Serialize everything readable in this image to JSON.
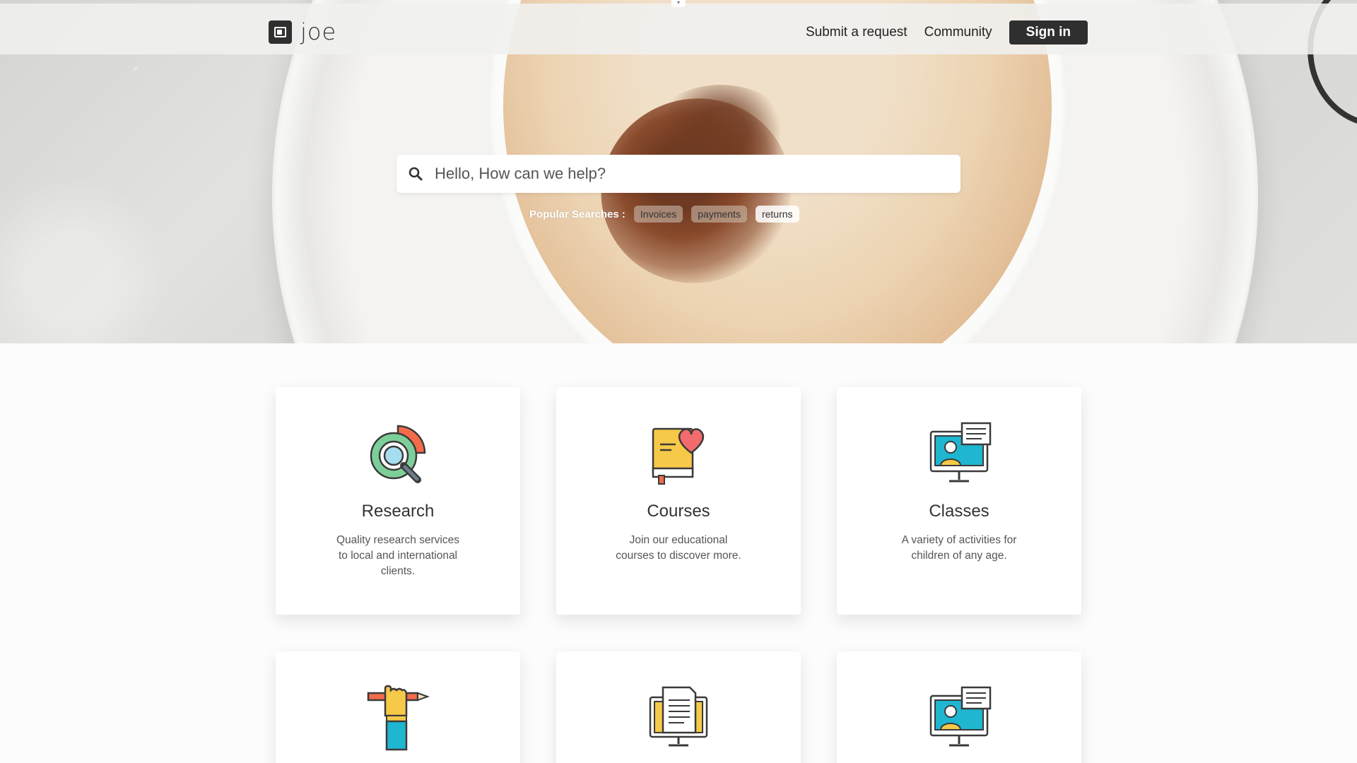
{
  "header": {
    "logo_text": "joe",
    "nav": [
      "Submit a request",
      "Community"
    ],
    "signin_label": "Sign in"
  },
  "search": {
    "placeholder": "Hello, How can we help?",
    "popular_label": "Popular Searches :",
    "popular": [
      "Invoices",
      "payments",
      "returns"
    ]
  },
  "cards": [
    {
      "title": "Research",
      "description": "Quality research services to local and international clients.",
      "icon": "research-chart-magnifier-icon"
    },
    {
      "title": "Courses",
      "description": "Join our educational courses to discover more.",
      "icon": "book-heart-icon"
    },
    {
      "title": "Classes",
      "description": "A variety of activities for children of any age.",
      "icon": "monitor-chat-icon"
    },
    {
      "title": "",
      "description": "",
      "icon": "hand-pencil-icon"
    },
    {
      "title": "",
      "description": "",
      "icon": "monitor-document-icon"
    },
    {
      "title": "",
      "description": "",
      "icon": "monitor-chat-icon"
    }
  ],
  "colors": {
    "header_bg": "#f0f0ef",
    "signin_bg": "#2f2f2f",
    "accent_orange": "#f26b4a",
    "accent_teal": "#1fb6d0",
    "accent_yellow": "#f7c948"
  }
}
